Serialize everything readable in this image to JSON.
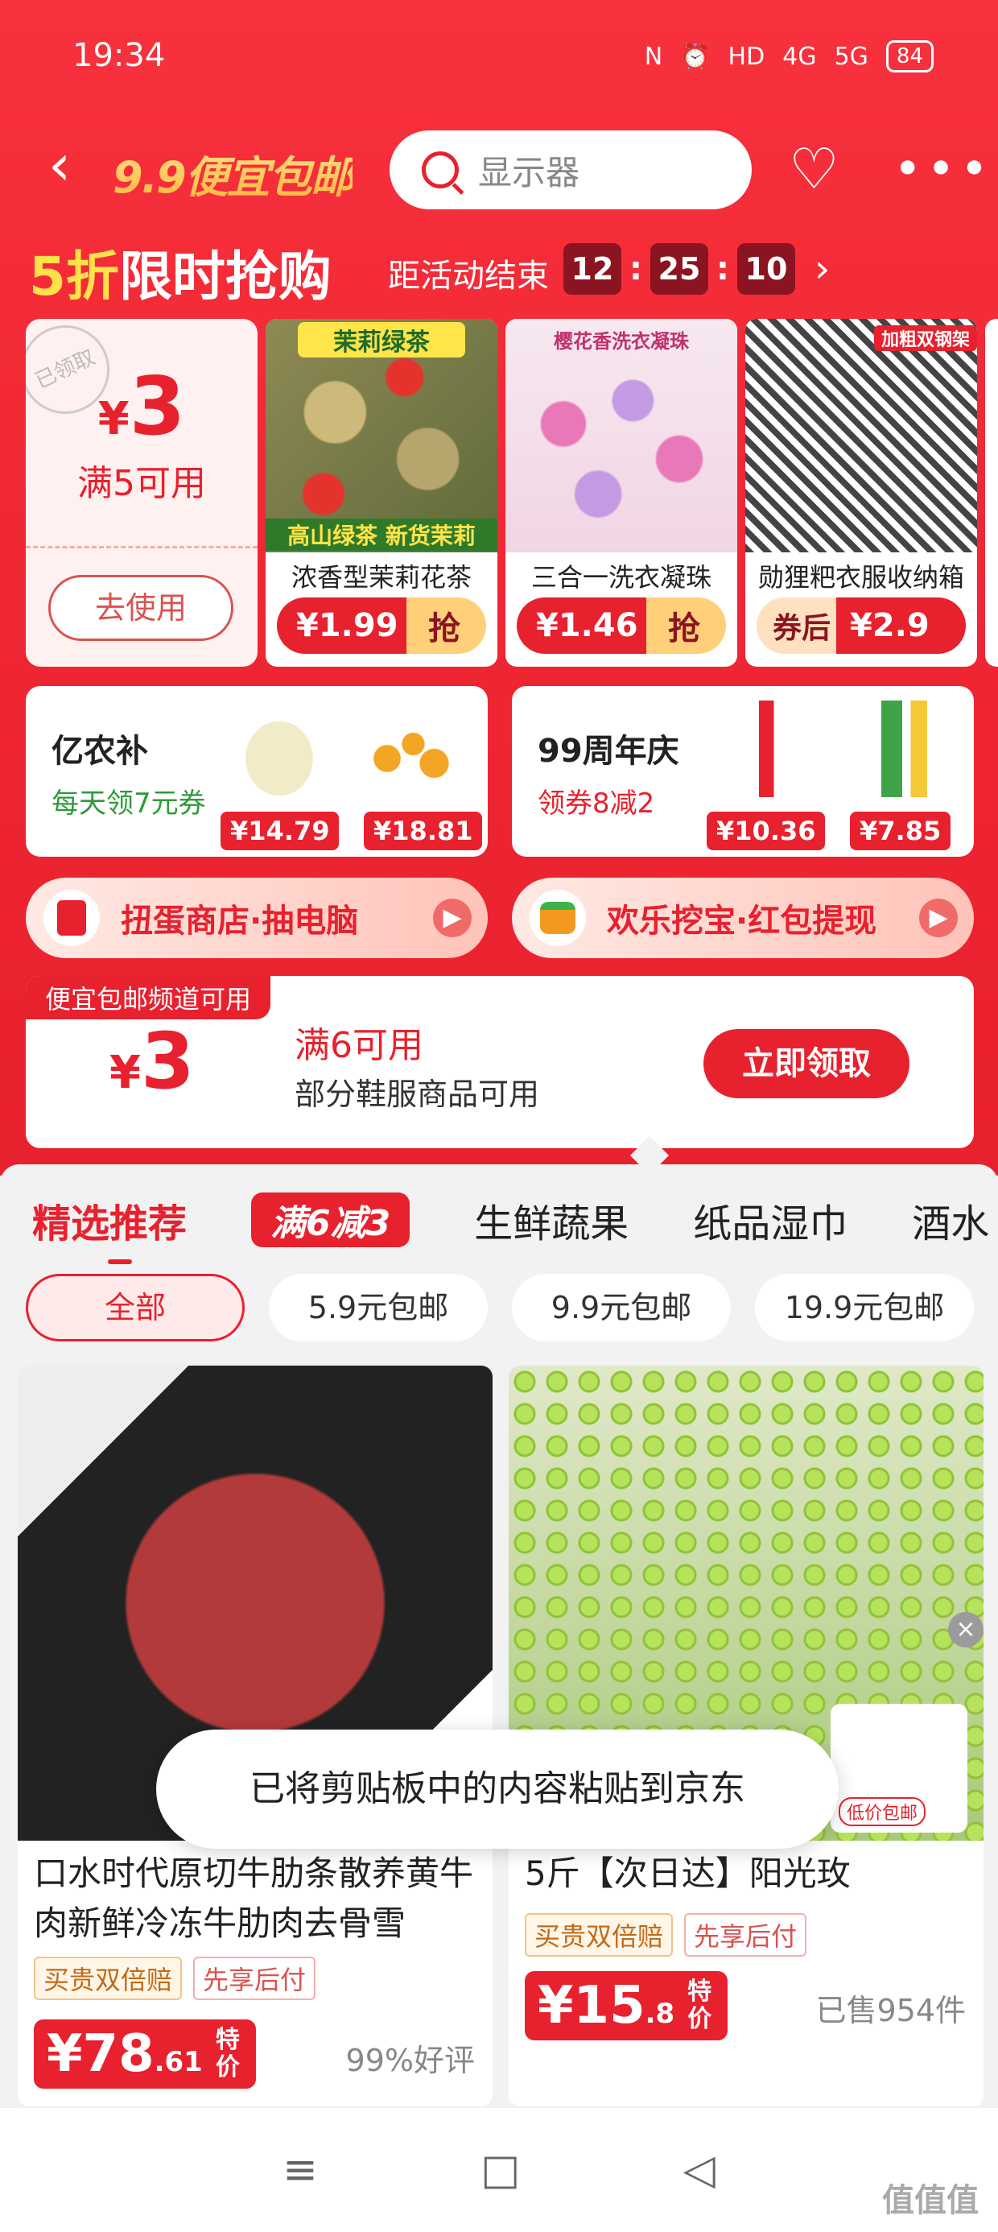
{
  "status_bar": {
    "time": "19:34",
    "icons": [
      "N",
      "⏰",
      "HD",
      "4G",
      "5G"
    ],
    "battery": "84"
  },
  "header": {
    "channel_logo": "9.9便宜包邮",
    "search_placeholder": "显示器"
  },
  "flash_sale": {
    "title_highlight": "5折",
    "title_rest": "限时抢购",
    "countdown_label": "距活动结束",
    "countdown": {
      "h": "12",
      "m": "25",
      "s": "10"
    },
    "coupon": {
      "stamp": "已领取",
      "currency": "¥",
      "amount": "3",
      "condition": "满5可用",
      "button": "去使用"
    },
    "products": [
      {
        "top_tag": "茉莉绿茶",
        "bottom_tag": "高山绿茶 新货茉莉",
        "name": "浓香型茉莉花茶",
        "price_int": "¥1.99",
        "action": "抢"
      },
      {
        "top_tag": "樱花香洗衣凝珠",
        "name": "三合一洗衣凝珠",
        "price_int": "¥1.46",
        "action": "抢"
      },
      {
        "top_tag": "加粗双钢架",
        "name": "勋狸粑衣服收纳箱",
        "coupon_label": "券后",
        "price_int": "¥2.9"
      }
    ]
  },
  "promos": [
    {
      "title": "亿农补",
      "subtitle": "每天领7元券",
      "prices": [
        "¥14.79",
        "¥18.81"
      ]
    },
    {
      "title": "99周年庆",
      "subtitle": "领券8减2",
      "prices": [
        "¥10.36",
        "¥7.85"
      ]
    }
  ],
  "pills": [
    {
      "label": "扭蛋商店·抽电脑",
      "icon": "red-packet-icon"
    },
    {
      "label": "欢乐挖宝·红包提现",
      "icon": "treasure-icon"
    }
  ],
  "coupon_bar": {
    "label": "便宜包邮频道可用",
    "currency": "¥",
    "amount": "3",
    "condition": "满6可用",
    "desc": "部分鞋服商品可用",
    "button": "立即领取"
  },
  "tabs": [
    "精选推荐",
    "满6减3",
    "生鲜蔬果",
    "纸品湿巾",
    "酒水"
  ],
  "filters": [
    "全部",
    "5.9元包邮",
    "9.9元包邮",
    "19.9元包邮"
  ],
  "products": [
    {
      "title": "口水时代原切牛肋条散养黄牛肉新鲜冷冻牛肋肉去骨雪",
      "tags": [
        "买贵双倍赔",
        "先享后付"
      ],
      "price": "¥78",
      "price_dec": ".61",
      "price_tag": "特价",
      "meta": "99%好评"
    },
    {
      "title": "5斤【次日达】阳光玫",
      "tags": [
        "买贵双倍赔",
        "先享后付"
      ],
      "price": "¥15",
      "price_dec": ".8",
      "price_tag": "特价",
      "meta": "已售954件"
    }
  ],
  "toast": "已将剪贴板中的内容粘贴到京东",
  "ad_label": "低价包邮",
  "watermark": "值值值"
}
